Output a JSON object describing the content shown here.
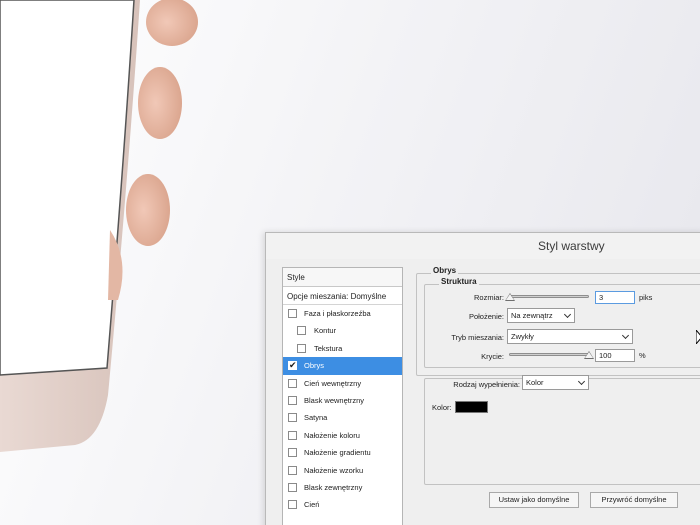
{
  "dialog": {
    "title": "Styl warstwy"
  },
  "left_panel": {
    "header": "Style",
    "blending_options": "Opcje mieszania: Domyślne",
    "effects": [
      {
        "label": "Faza i płaskorzeźba",
        "checked": false,
        "selected": false,
        "sub": false
      },
      {
        "label": "Kontur",
        "checked": false,
        "selected": false,
        "sub": true
      },
      {
        "label": "Tekstura",
        "checked": false,
        "selected": false,
        "sub": true
      },
      {
        "label": "Obrys",
        "checked": true,
        "selected": true,
        "sub": false
      },
      {
        "label": "Cień wewnętrzny",
        "checked": false,
        "selected": false,
        "sub": false
      },
      {
        "label": "Blask wewnętrzny",
        "checked": false,
        "selected": false,
        "sub": false
      },
      {
        "label": "Satyna",
        "checked": false,
        "selected": false,
        "sub": false
      },
      {
        "label": "Nałożenie koloru",
        "checked": false,
        "selected": false,
        "sub": false
      },
      {
        "label": "Nałożenie gradientu",
        "checked": false,
        "selected": false,
        "sub": false
      },
      {
        "label": "Nałożenie wzorku",
        "checked": false,
        "selected": false,
        "sub": false
      },
      {
        "label": "Blask zewnętrzny",
        "checked": false,
        "selected": false,
        "sub": false
      },
      {
        "label": "Cień",
        "checked": false,
        "selected": false,
        "sub": false
      }
    ]
  },
  "stroke": {
    "group_title": "Obrys",
    "structure_title": "Struktura",
    "size_label": "Rozmiar:",
    "size_value": "3",
    "size_unit": "piks",
    "size_slider": 0.01,
    "position_label": "Położenie:",
    "position_value": "Na zewnątrz",
    "blend_label": "Tryb mieszania:",
    "blend_value": "Zwykły",
    "opacity_label": "Krycie:",
    "opacity_value": "100",
    "opacity_unit": "%",
    "opacity_slider": 1.0,
    "fill_type_label": "Rodzaj wypełnienia:",
    "fill_type_value": "Kolor",
    "color_label": "Kolor:",
    "color_value": "#000000"
  },
  "buttons": {
    "make_default": "Ustaw jako domyślne",
    "reset_default": "Przywróć domyślne"
  }
}
